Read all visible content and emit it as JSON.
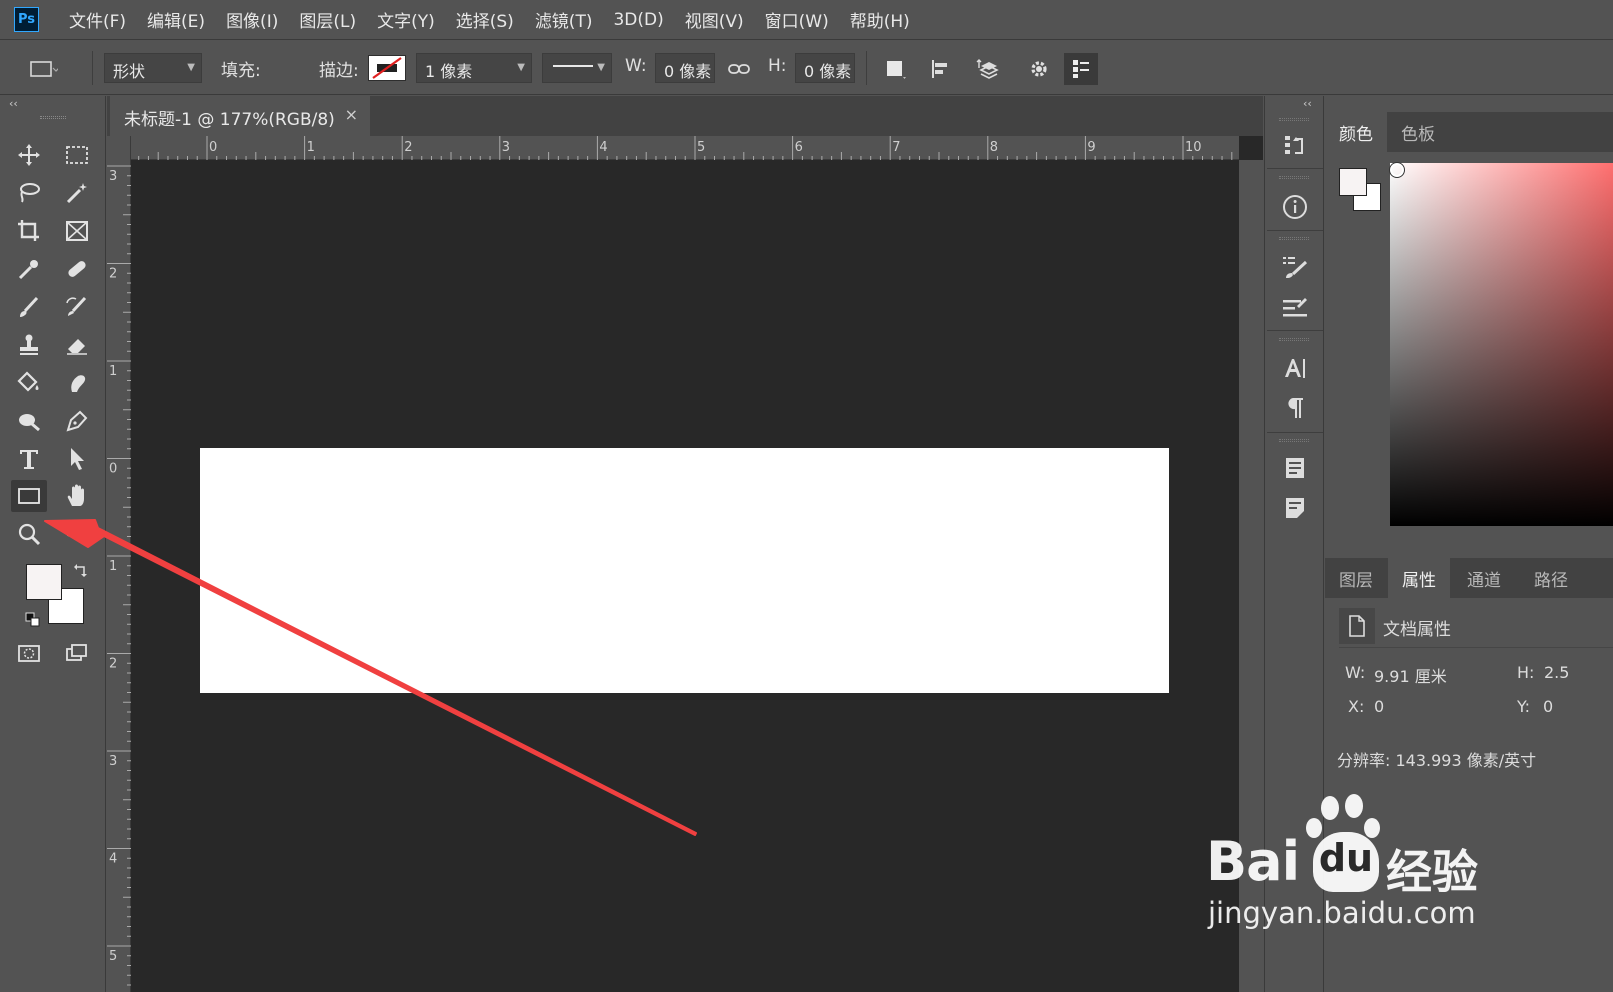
{
  "app": {
    "logo_text": "Ps"
  },
  "menu": [
    "文件(F)",
    "编辑(E)",
    "图像(I)",
    "图层(L)",
    "文字(Y)",
    "选择(S)",
    "滤镜(T)",
    "3D(D)",
    "视图(V)",
    "窗口(W)",
    "帮助(H)"
  ],
  "options": {
    "mode": "形状",
    "fill_label": "填充:",
    "stroke_label": "描边:",
    "stroke_width": "1 像素",
    "w_label": "W:",
    "w_value": "0 像素",
    "h_label": "H:",
    "h_value": "0 像素"
  },
  "document": {
    "tab_title": "未标题-1 @ 177%(RGB/8)",
    "close_glyph": "×",
    "hruler_numbers": [
      "0",
      "1",
      "2",
      "3",
      "4",
      "5",
      "6",
      "7",
      "8",
      "9",
      "10"
    ],
    "vruler_numbers": [
      "3",
      "2",
      "1",
      "0",
      "1",
      "2",
      "3",
      "4",
      "5"
    ]
  },
  "toolbar": {
    "collapse_glyph": "‹‹"
  },
  "dock": {
    "collapse_glyph": "‹‹"
  },
  "color_panel": {
    "tabs": [
      "颜色",
      "色板"
    ],
    "fg_color": "#f7f3f3",
    "bg_color": "#ffffff"
  },
  "props_panel": {
    "tabs": [
      "图层",
      "属性",
      "通道",
      "路径"
    ],
    "active_tab": "属性",
    "section_title": "文档属性",
    "w_label": "W:",
    "w_value": "9.91 厘米",
    "h_label": "H:",
    "h_value": "2.5",
    "x_label": "X:",
    "x_value": "0",
    "y_label": "Y:",
    "y_value": "0",
    "resolution": "分辨率: 143.993 像素/英寸"
  },
  "watermark": {
    "brand_left": "Bai",
    "brand_mid": "du",
    "brand_right": "经验",
    "url": "jingyan.baidu.com"
  },
  "colors": {
    "ui_bg": "#535353",
    "canvas_bg": "#282828",
    "arrow": "#f04040",
    "ps_blue": "#31a8ff"
  }
}
